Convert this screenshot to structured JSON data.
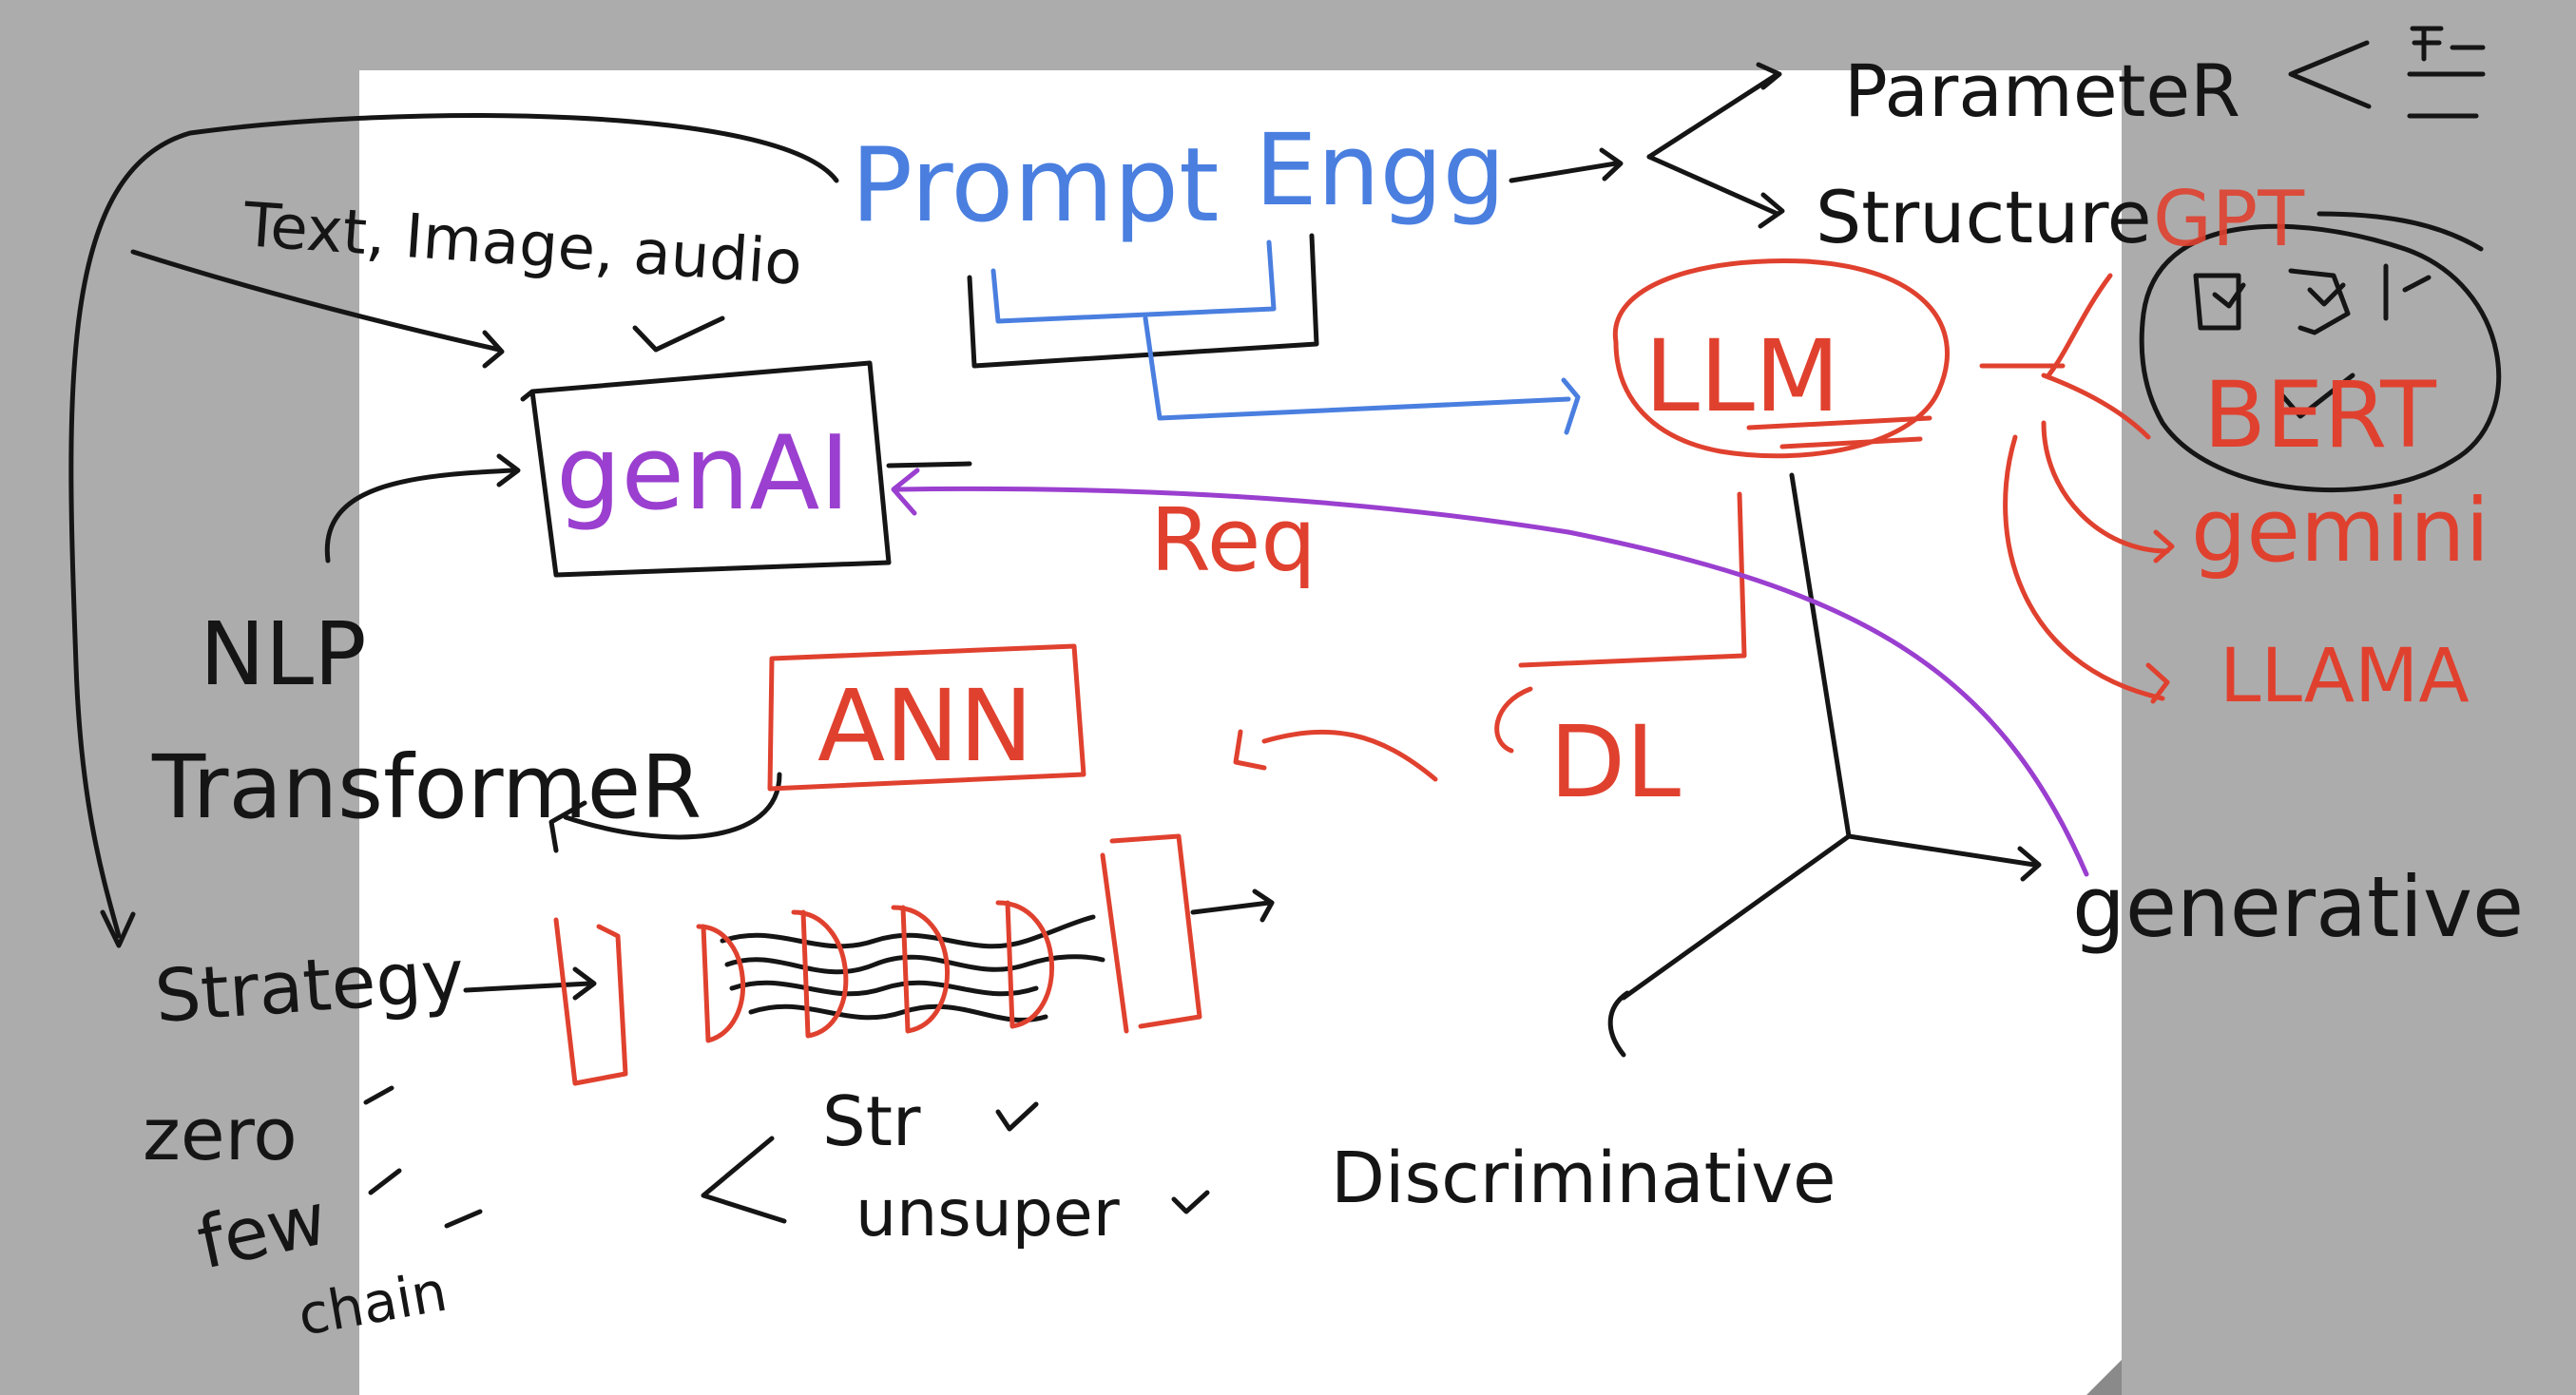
{
  "colors": {
    "background": "#acacac",
    "board": "#ffffff",
    "ink_black": "#151515",
    "ink_blue": "#4a7fe0",
    "ink_red": "#e0412f",
    "ink_purple": "#9a3fcf"
  },
  "labels": {
    "text_image_audio": "Text, Image, audio",
    "prompt": "Prompt",
    "engg": "Engg",
    "parameter": "ParameteR",
    "structure": "Structure",
    "gpt": "GPT",
    "bert": "BERT",
    "gemini": "gemini",
    "llama": "LLAMA",
    "llm": "LLM",
    "genai": "genAI",
    "req": "Req",
    "nlp": "NLP",
    "transformer": "TransformeR",
    "ann": "ANN",
    "dl": "DL",
    "generative": "generative",
    "strategy": "Strategy",
    "zero": "zero",
    "few": "few",
    "chain": "chain",
    "str": "Str",
    "unsupervised": "unsuper",
    "discriminative": "Discriminative"
  }
}
